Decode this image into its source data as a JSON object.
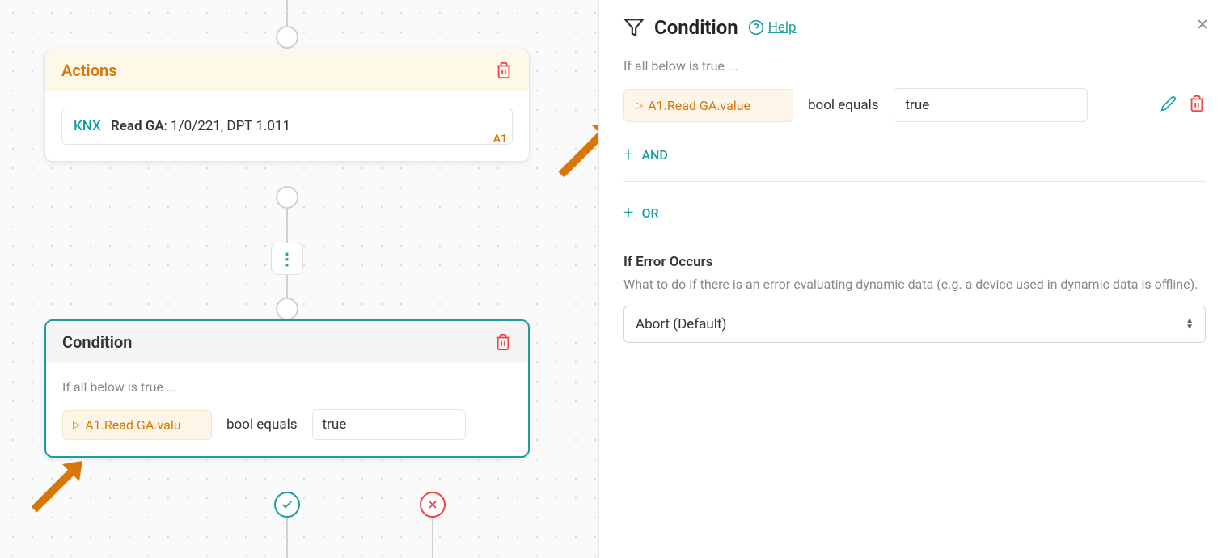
{
  "canvas": {
    "actions_card": {
      "title": "Actions",
      "action": {
        "tag": "KNX",
        "label": "Read GA",
        "params": ": 1/0/221, DPT 1.011",
        "id": "A1"
      }
    },
    "condition_card": {
      "title": "Condition",
      "subtitle": "If all below is true ...",
      "chip": "A1.Read GA.valu",
      "operator": "bool equals",
      "value": "true"
    }
  },
  "panel": {
    "title": "Condition",
    "help": "Help",
    "subtitle": "If all below is true ...",
    "condition": {
      "chip": "A1.Read GA.value",
      "operator": "bool equals",
      "value": "true"
    },
    "add_and": "AND",
    "add_or": "OR",
    "error_section": {
      "title": "If Error Occurs",
      "desc": "What to do if there is an error evaluating dynamic data (e.g. a device used in dynamic data is offline).",
      "selected": "Abort (Default)"
    }
  }
}
